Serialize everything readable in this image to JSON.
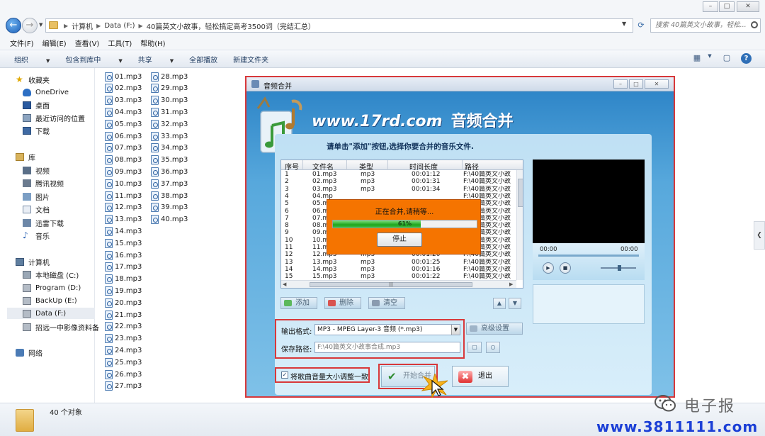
{
  "window": {
    "controls": [
      "–",
      "□",
      "✕"
    ]
  },
  "address": {
    "crumbs": [
      "计算机",
      "Data (F:)",
      "40篇英文小故事，轻松搞定高考3500词（完结汇总）"
    ],
    "search_placeholder": "搜索 40篇英文小故事，轻松..."
  },
  "menu": [
    "文件(F)",
    "编辑(E)",
    "查看(V)",
    "工具(T)",
    "帮助(H)"
  ],
  "toolbar": {
    "organize": "组织",
    "include_in_library": "包含到库中",
    "share": "共享",
    "burn": "全部播放",
    "new_folder": "新建文件夹"
  },
  "sidebar": {
    "favorites": "收藏夹",
    "favorites_items": [
      "OneDrive",
      "桌面",
      "最近访问的位置",
      "下载"
    ],
    "libraries": "库",
    "library_items": [
      "视频",
      "腾讯视频",
      "图片",
      "文档",
      "迅雷下载",
      "音乐"
    ],
    "computer": "计算机",
    "drives": [
      "本地磁盘 (C:)",
      "Program (D:)",
      "BackUp (E:)",
      "Data (F:)",
      "招远一中影像资料备"
    ],
    "network": "网络"
  },
  "files": [
    "01.mp3",
    "02.mp3",
    "03.mp3",
    "04.mp3",
    "05.mp3",
    "06.mp3",
    "07.mp3",
    "08.mp3",
    "09.mp3",
    "10.mp3",
    "11.mp3",
    "12.mp3",
    "13.mp3",
    "14.mp3",
    "15.mp3",
    "16.mp3",
    "17.mp3",
    "18.mp3",
    "19.mp3",
    "20.mp3",
    "21.mp3",
    "22.mp3",
    "23.mp3",
    "24.mp3",
    "25.mp3",
    "26.mp3",
    "27.mp3",
    "28.mp3",
    "29.mp3",
    "30.mp3",
    "31.mp3",
    "32.mp3",
    "33.mp3",
    "34.mp3",
    "35.mp3",
    "36.mp3",
    "37.mp3",
    "38.mp3",
    "39.mp3",
    "40.mp3"
  ],
  "status": {
    "count": "40 个对象"
  },
  "dialog": {
    "title": "音频合并",
    "brand": "www.17rd.com",
    "brand_cn": "音频合并",
    "instruction": "请单击\"添加\"按钮,选择你要合并的音乐文件.",
    "columns": [
      "序号",
      "文件名",
      "类型",
      "时间长度",
      "路径"
    ],
    "rows": [
      [
        "1",
        "01.mp3",
        "mp3",
        "00:01:12",
        "F:\\40篇英文小故"
      ],
      [
        "2",
        "02.mp3",
        "mp3",
        "00:01:31",
        "F:\\40篇英文小故"
      ],
      [
        "3",
        "03.mp3",
        "mp3",
        "00:01:34",
        "F:\\40篇英文小故"
      ],
      [
        "4",
        "04.mp",
        "",
        "",
        "F:\\40篇英文小故"
      ],
      [
        "5",
        "05.mp",
        "",
        "",
        "F:\\40篇英文小故"
      ],
      [
        "6",
        "06.mp",
        "",
        "",
        "F:\\40篇英文小故"
      ],
      [
        "7",
        "07.mp",
        "",
        "",
        "F:\\40篇英文小故"
      ],
      [
        "8",
        "08.mp",
        "",
        "",
        "F:\\40篇英文小故"
      ],
      [
        "9",
        "09.mp",
        "",
        "",
        "F:\\40篇英文小故"
      ],
      [
        "10",
        "10.mp",
        "",
        "",
        "F:\\40篇英文小故"
      ],
      [
        "11",
        "11.mp3",
        "mp3",
        "00:01:33",
        "F:\\40篇英文小故"
      ],
      [
        "12",
        "12.mp3",
        "mp3",
        "00:01:20",
        "F:\\40篇英文小故"
      ],
      [
        "13",
        "13.mp3",
        "mp3",
        "00:01:25",
        "F:\\40篇英文小故"
      ],
      [
        "14",
        "14.mp3",
        "mp3",
        "00:01:16",
        "F:\\40篇英文小故"
      ],
      [
        "15",
        "15.mp3",
        "mp3",
        "00:01:22",
        "F:\\40篇英文小故"
      ]
    ],
    "progress": {
      "message": "正在合并,请稍等...",
      "percent": 61,
      "percent_label": "61%",
      "stop": "停止"
    },
    "player": {
      "time_start": "00:00",
      "time_end": "00:00"
    },
    "buttons": {
      "add": "添加",
      "delete": "删除",
      "clear": "清空",
      "advanced": "高级设置",
      "start": "开始合并",
      "exit": "退出"
    },
    "format_label": "输出格式:",
    "format_value": "MP3 - MPEG Layer-3 音频 (*.mp3)",
    "path_label": "保存路径:",
    "path_value": "F:\\40篇英文小故事合成.mp3",
    "normalize_label": "将歌曲音量大小调整一致",
    "normalize_checked": true
  },
  "watermark": {
    "wechat": "电子报",
    "url": "www.3811111.com"
  },
  "colors": {
    "accent_red": "#d8383a",
    "progress_orange": "#f57400",
    "progress_green": "#1ea51e",
    "dialog_blue": "#4f9fd4"
  }
}
